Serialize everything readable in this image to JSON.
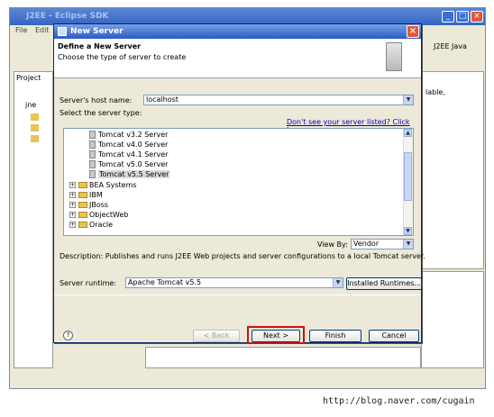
{
  "eclipse": {
    "title": "J2EE - Eclipse SDK",
    "menu": [
      "File",
      "Edit"
    ],
    "perspective": "J2EE",
    "perspective2": "Java",
    "project_panel_label": "Project",
    "tree_root": "jne",
    "right_text": "lable,",
    "window_buttons": [
      "_",
      "□",
      "×"
    ]
  },
  "dialog": {
    "title": "New Server",
    "close": "×",
    "header_title": "Define a New Server",
    "header_subtitle": "Choose the type of server to create",
    "host_label": "Server's host name:",
    "host_value": "localhost",
    "type_label": "Select the server type:",
    "link": "Don't see your server listed? Click here",
    "tree": {
      "servers": [
        "Tomcat v3.2 Server",
        "Tomcat v4.0 Server",
        "Tomcat v4.1 Server",
        "Tomcat v5.0 Server",
        "Tomcat v5.5 Server"
      ],
      "selected": "Tomcat v5.5 Server",
      "vendors": [
        "BEA Systems",
        "IBM",
        "JBoss",
        "ObjectWeb",
        "Oracle"
      ]
    },
    "view_by_label": "View By:",
    "view_by_value": "Vendor",
    "description": "Description: Publishes and runs J2EE Web projects and server configurations to a local Tomcat server.",
    "runtime_label": "Server runtime:",
    "runtime_value": "Apache Tomcat v5.5",
    "installed_runtimes": "Installed Runtimes...",
    "help_icon": "?",
    "back": "< Back",
    "next": "Next >",
    "finish": "Finish",
    "cancel": "Cancel"
  },
  "watermark": "http://blog.naver.com/cugain",
  "colors": {
    "title_blue": "#2a5ac6",
    "highlight_red": "#d01010",
    "selection": "#d9d9d9"
  }
}
